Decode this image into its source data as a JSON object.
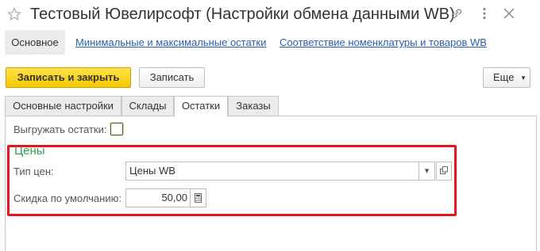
{
  "window": {
    "title": "Тестовый Ювелирсофт (Настройки обмена данными WB)"
  },
  "nav": {
    "main": "Основное",
    "links": [
      "Минимальные и максимальные остатки",
      "Соответствие номенклатуры и товаров WB"
    ]
  },
  "toolbar": {
    "save_close": "Записать и закрыть",
    "save": "Записать",
    "more": "Еще"
  },
  "tabs": [
    "Основные настройки",
    "Склады",
    "Остатки",
    "Заказы"
  ],
  "active_tab": "Остатки",
  "form": {
    "export_stock_label": "Выгружать остатки:",
    "export_stock_checked": false,
    "group_title": "Цены",
    "price_type_label": "Тип цен:",
    "price_type_value": "Цены WB",
    "discount_label": "Скидка по умолчанию:",
    "discount_value": "50,00"
  },
  "icons": {
    "favorite": "star-icon",
    "link": "link-icon",
    "menu": "more-icon",
    "close": "close-icon",
    "dropdown": "chevron-down-icon",
    "open": "open-icon",
    "calculator": "calculator-icon"
  },
  "colors": {
    "accent": "#f5c800",
    "highlight": "#e8141b",
    "group_title": "#2f9e4f",
    "link": "#2b5ea8"
  }
}
